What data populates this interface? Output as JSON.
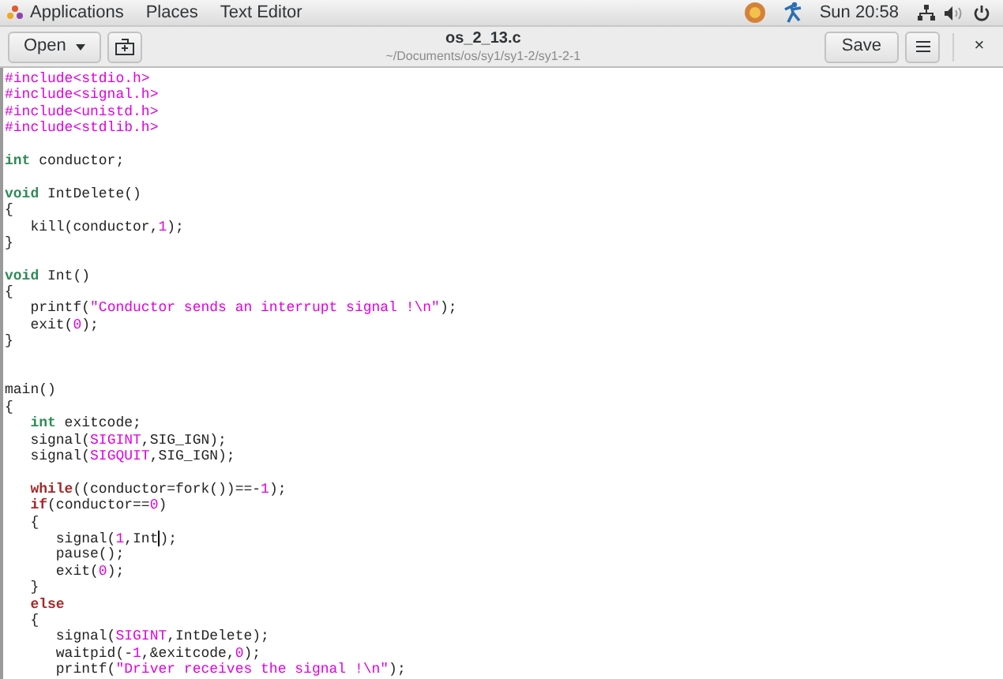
{
  "top_bar": {
    "menus": [
      "Applications",
      "Places",
      "Text Editor"
    ],
    "clock": "Sun 20:58"
  },
  "header": {
    "open_button": "Open",
    "title": "os_2_13.c",
    "subtitle": "~/Documents/os/sy1/sy1-2/sy1-2-1",
    "save_button": "Save",
    "close": "×"
  },
  "editor": {
    "lines": [
      {
        "kind": "code",
        "tokens": [
          {
            "kind": "preproc",
            "text": "#include<stdio.h>"
          }
        ]
      },
      {
        "kind": "code",
        "tokens": [
          {
            "kind": "preproc",
            "text": "#include<signal.h>"
          }
        ]
      },
      {
        "kind": "code",
        "tokens": [
          {
            "kind": "preproc",
            "text": "#include<unistd.h>"
          }
        ]
      },
      {
        "kind": "code",
        "tokens": [
          {
            "kind": "preproc",
            "text": "#include<stdlib.h>"
          }
        ]
      },
      {
        "kind": "blank"
      },
      {
        "kind": "code",
        "tokens": [
          {
            "kind": "type",
            "text": "int"
          },
          {
            "kind": "plain",
            "text": " conductor;"
          }
        ]
      },
      {
        "kind": "blank"
      },
      {
        "kind": "code",
        "tokens": [
          {
            "kind": "type",
            "text": "void"
          },
          {
            "kind": "plain",
            "text": " IntDelete()"
          }
        ]
      },
      {
        "kind": "code",
        "tokens": [
          {
            "kind": "plain",
            "text": "{"
          }
        ]
      },
      {
        "kind": "code",
        "tokens": [
          {
            "kind": "plain",
            "text": "   kill(conductor,"
          },
          {
            "kind": "number",
            "text": "1"
          },
          {
            "kind": "plain",
            "text": ");"
          }
        ]
      },
      {
        "kind": "code",
        "tokens": [
          {
            "kind": "plain",
            "text": "}"
          }
        ]
      },
      {
        "kind": "blank"
      },
      {
        "kind": "code",
        "tokens": [
          {
            "kind": "type",
            "text": "void"
          },
          {
            "kind": "plain",
            "text": " Int()"
          }
        ]
      },
      {
        "kind": "code",
        "tokens": [
          {
            "kind": "plain",
            "text": "{"
          }
        ]
      },
      {
        "kind": "code",
        "tokens": [
          {
            "kind": "plain",
            "text": "   printf("
          },
          {
            "kind": "string",
            "text": "\"Conductor sends an interrupt signal !\\n\""
          },
          {
            "kind": "plain",
            "text": ");"
          }
        ]
      },
      {
        "kind": "code",
        "tokens": [
          {
            "kind": "plain",
            "text": "   exit("
          },
          {
            "kind": "number",
            "text": "0"
          },
          {
            "kind": "plain",
            "text": ");"
          }
        ]
      },
      {
        "kind": "code",
        "tokens": [
          {
            "kind": "plain",
            "text": "}"
          }
        ]
      },
      {
        "kind": "blank"
      },
      {
        "kind": "blank"
      },
      {
        "kind": "code",
        "tokens": [
          {
            "kind": "plain",
            "text": "main()"
          }
        ]
      },
      {
        "kind": "code",
        "tokens": [
          {
            "kind": "plain",
            "text": "{"
          }
        ]
      },
      {
        "kind": "code",
        "tokens": [
          {
            "kind": "type",
            "text": "   int"
          },
          {
            "kind": "plain",
            "text": " exitcode;"
          }
        ]
      },
      {
        "kind": "code",
        "tokens": [
          {
            "kind": "plain",
            "text": "   signal("
          },
          {
            "kind": "number",
            "text": "SIGINT"
          },
          {
            "kind": "plain",
            "text": ",SIG_IGN);"
          }
        ]
      },
      {
        "kind": "code",
        "tokens": [
          {
            "kind": "plain",
            "text": "   signal("
          },
          {
            "kind": "number",
            "text": "SIGQUIT"
          },
          {
            "kind": "plain",
            "text": ",SIG_IGN);"
          }
        ]
      },
      {
        "kind": "blank"
      },
      {
        "kind": "code",
        "tokens": [
          {
            "kind": "keyword",
            "text": "   while"
          },
          {
            "kind": "plain",
            "text": "((conductor=fork())==-"
          },
          {
            "kind": "number",
            "text": "1"
          },
          {
            "kind": "plain",
            "text": ");"
          }
        ]
      },
      {
        "kind": "code",
        "tokens": [
          {
            "kind": "keyword",
            "text": "   if"
          },
          {
            "kind": "plain",
            "text": "(conductor=="
          },
          {
            "kind": "number",
            "text": "0"
          },
          {
            "kind": "plain",
            "text": ")"
          }
        ]
      },
      {
        "kind": "code",
        "tokens": [
          {
            "kind": "plain",
            "text": "   {"
          }
        ]
      },
      {
        "kind": "code",
        "tokens": [
          {
            "kind": "plain",
            "text": "      signal("
          },
          {
            "kind": "number",
            "text": "1"
          },
          {
            "kind": "plain",
            "text": ",Int",
            "cursor_after": true
          },
          {
            "kind": "plain",
            "text": ");"
          }
        ]
      },
      {
        "kind": "code",
        "tokens": [
          {
            "kind": "plain",
            "text": "      pause();"
          }
        ]
      },
      {
        "kind": "code",
        "tokens": [
          {
            "kind": "plain",
            "text": "      exit("
          },
          {
            "kind": "number",
            "text": "0"
          },
          {
            "kind": "plain",
            "text": ");"
          }
        ]
      },
      {
        "kind": "code",
        "tokens": [
          {
            "kind": "plain",
            "text": "   }"
          }
        ]
      },
      {
        "kind": "code",
        "tokens": [
          {
            "kind": "keyword",
            "text": "   else"
          }
        ]
      },
      {
        "kind": "code",
        "tokens": [
          {
            "kind": "plain",
            "text": "   {"
          }
        ]
      },
      {
        "kind": "code",
        "tokens": [
          {
            "kind": "plain",
            "text": "      signal("
          },
          {
            "kind": "number",
            "text": "SIGINT"
          },
          {
            "kind": "plain",
            "text": ",IntDelete);"
          }
        ]
      },
      {
        "kind": "code",
        "tokens": [
          {
            "kind": "plain",
            "text": "      waitpid(-"
          },
          {
            "kind": "number",
            "text": "1"
          },
          {
            "kind": "plain",
            "text": ",&exitcode,"
          },
          {
            "kind": "number",
            "text": "0"
          },
          {
            "kind": "plain",
            "text": ");"
          }
        ]
      },
      {
        "kind": "code",
        "tokens": [
          {
            "kind": "plain",
            "text": "      printf("
          },
          {
            "kind": "string",
            "text": "\"Driver receives the signal !\\n\""
          },
          {
            "kind": "plain",
            "text": ");"
          }
        ]
      }
    ]
  }
}
